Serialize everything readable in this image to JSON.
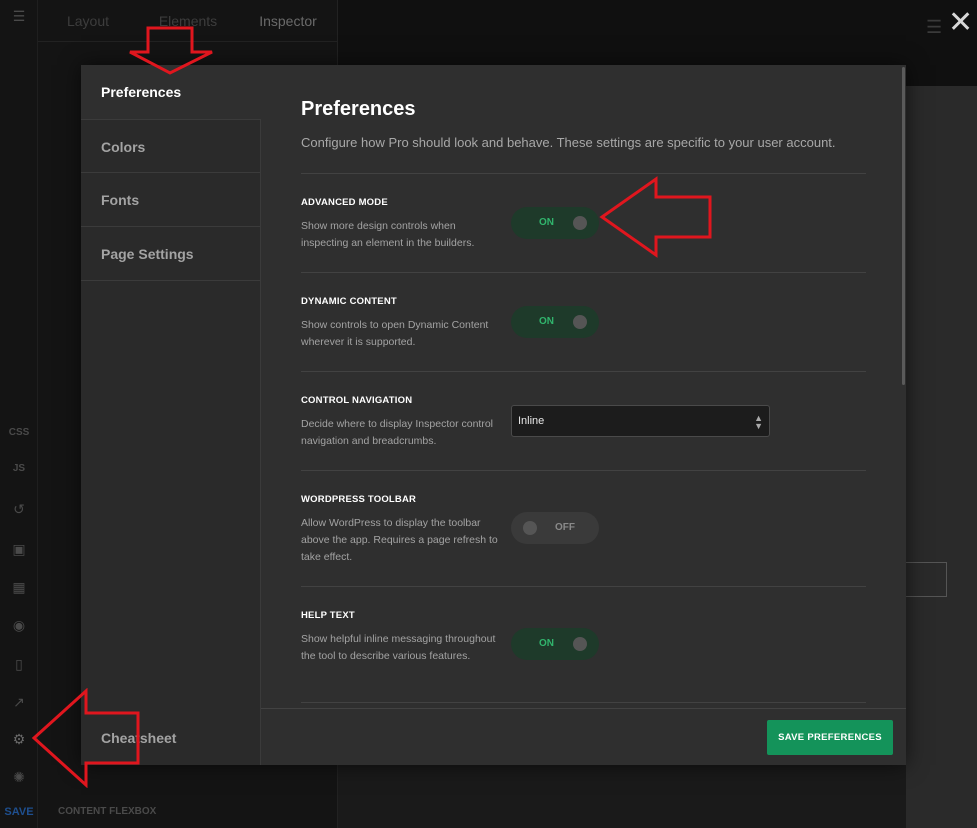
{
  "background": {
    "inspector_tabs": [
      "Layout",
      "Elements",
      "Inspector"
    ],
    "rail_items": {
      "css": "CSS",
      "js": "JS",
      "save": "SAVE"
    },
    "content_flexbox_label": "CONTENT FLEXBOX"
  },
  "modal": {
    "sidebar": {
      "items": [
        {
          "label": "Preferences",
          "active": true
        },
        {
          "label": "Colors",
          "active": false
        },
        {
          "label": "Fonts",
          "active": false
        },
        {
          "label": "Page Settings",
          "active": false
        }
      ],
      "cheatsheet": "Cheatsheet"
    },
    "title": "Preferences",
    "subtitle": "Configure how Pro should look and behave. These settings are specific to your user account.",
    "settings": [
      {
        "label": "ADVANCED MODE",
        "description": "Show more design controls when inspecting an element in the builders.",
        "control": "toggle",
        "value": "ON"
      },
      {
        "label": "DYNAMIC CONTENT",
        "description": "Show controls to open Dynamic Content wherever it is supported.",
        "control": "toggle",
        "value": "ON"
      },
      {
        "label": "CONTROL NAVIGATION",
        "description": "Decide where to display Inspector control navigation and breadcrumbs.",
        "control": "select",
        "value": "Inline"
      },
      {
        "label": "WORDPRESS TOOLBAR",
        "description": "Allow WordPress to display the toolbar above the app. Requires a page refresh to take effect.",
        "control": "toggle",
        "value": "OFF"
      },
      {
        "label": "HELP TEXT",
        "description": "Show helpful inline messaging throughout the tool to describe various features.",
        "control": "toggle",
        "value": "ON"
      }
    ],
    "save_label": "SAVE PREFERENCES"
  },
  "colors": {
    "accent_green": "#14935a",
    "toggle_on_text": "#31b56d",
    "annotation_red": "#e0161e"
  },
  "icons": [
    "menu-icon",
    "history-icon",
    "layout-icon",
    "layers-icon",
    "globe-icon",
    "device-icon",
    "external-link-icon",
    "gear-icon",
    "bug-icon",
    "close-icon",
    "select-caret-icon"
  ]
}
